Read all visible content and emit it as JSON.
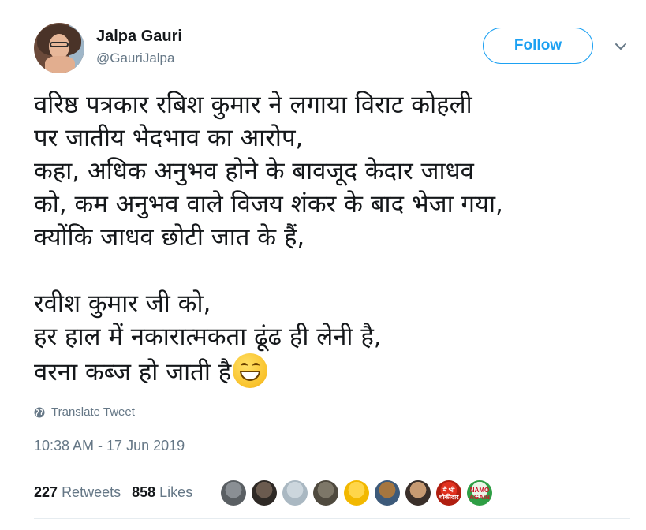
{
  "author": {
    "name": "Jalpa Gauri",
    "handle": "@GauriJalpa"
  },
  "follow_label": "Follow",
  "tweet": {
    "lines": [
      "वरिष्ठ पत्रकार रबिश कुमार ने लगाया विराट कोहली",
      "पर जातीय भेदभाव का आरोप,",
      "कहा, अधिक अनुभव होने के बावजूद केदार जाधव",
      "को, कम अनुभव वाले विजय शंकर के बाद भेजा गया,",
      "क्योंकि जाधव छोटी जात के हैं,",
      "",
      "रवीश कुमार जी को,",
      "हर हाल में नकारात्मकता ढूंढ ही लेनी है,",
      "वरना कब्ज हो जाती है"
    ],
    "emoji": "grinning-face-emoji"
  },
  "translate_label": "Translate Tweet",
  "timestamp": "10:38 AM - 17 Jun 2019",
  "stats": {
    "retweets_count": "227",
    "retweets_label": "Retweets",
    "likes_count": "858",
    "likes_label": "Likes"
  },
  "likers": [
    {
      "colors": [
        "#8a8f94",
        "#5a5f63"
      ],
      "text": ""
    },
    {
      "colors": [
        "#6b5b4f",
        "#2f2a26"
      ],
      "text": ""
    },
    {
      "colors": [
        "#ccd6dd",
        "#aab8c2"
      ],
      "text": ""
    },
    {
      "colors": [
        "#7d7768",
        "#4f4a3f"
      ],
      "text": ""
    },
    {
      "colors": [
        "#ffd64a",
        "#f2b800"
      ],
      "text": ""
    },
    {
      "colors": [
        "#a6763f",
        "#3d5a7a"
      ],
      "text": ""
    },
    {
      "colors": [
        "#c79a72",
        "#3a2f2a"
      ],
      "text": ""
    },
    {
      "colors": [
        "#e0301e",
        "#b01e10"
      ],
      "text": "मैं भी चौकीदार"
    },
    {
      "colors": [
        "#e9f5e6",
        "#2e9e44"
      ],
      "text": "NAMO AGAIN"
    }
  ],
  "colors": {
    "accent": "#1da1f2",
    "text": "#14171a",
    "muted": "#657786"
  }
}
